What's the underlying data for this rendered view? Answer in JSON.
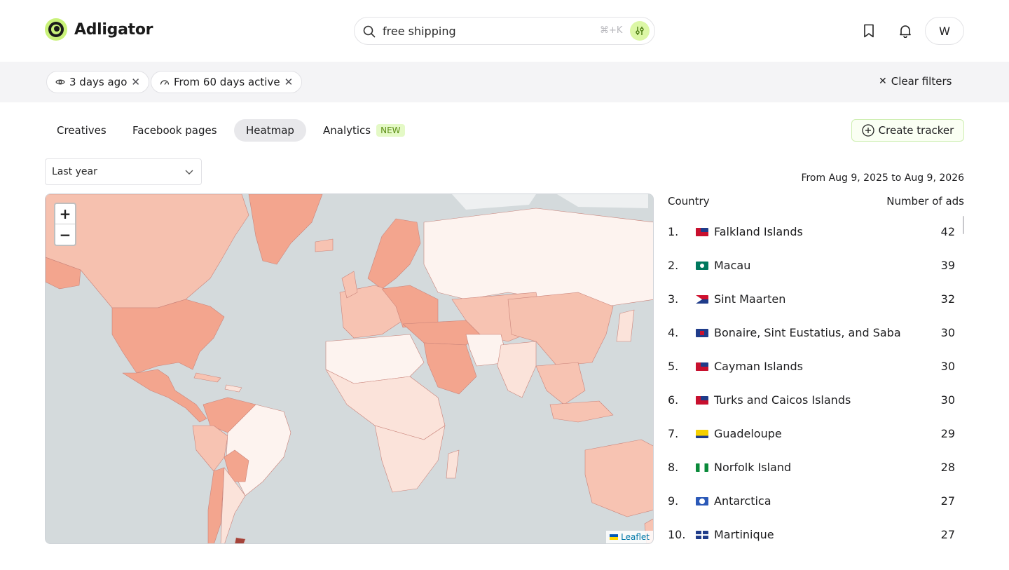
{
  "app": {
    "name": "Adligator"
  },
  "search": {
    "value": "free shipping",
    "shortcut": "⌘+K"
  },
  "user": {
    "initial": "W"
  },
  "filters": {
    "chips": [
      {
        "label": "3 days ago",
        "icon": "eye-icon"
      },
      {
        "label": "From 60 days active",
        "icon": "gauge-icon"
      }
    ],
    "clear_label": "Clear filters"
  },
  "tabs": [
    {
      "label": "Creatives",
      "active": false
    },
    {
      "label": "Facebook pages",
      "active": false
    },
    {
      "label": "Heatmap",
      "active": true
    },
    {
      "label": "Analytics",
      "active": false,
      "badge": "NEW"
    }
  ],
  "create_tracker_label": "Create tracker",
  "period": {
    "selected": "Last year"
  },
  "date_range": "From Aug 9, 2025 to Aug 9, 2026",
  "map": {
    "zoom_in": "+",
    "zoom_out": "−",
    "attribution": "Leaflet"
  },
  "table": {
    "col_country": "Country",
    "col_ads": "Number of ads",
    "rows": [
      {
        "rank": "1.",
        "country": "Falkland Islands",
        "ads": "42",
        "flag": "blue-ensign"
      },
      {
        "rank": "2.",
        "country": "Macau",
        "ads": "39",
        "flag": "green-white"
      },
      {
        "rank": "3.",
        "country": "Sint Maarten",
        "ads": "32",
        "flag": "red-white-blue"
      },
      {
        "rank": "4.",
        "country": "Bonaire, Sint Eustatius, and Saba",
        "ads": "30",
        "flag": "blue-red"
      },
      {
        "rank": "5.",
        "country": "Cayman Islands",
        "ads": "30",
        "flag": "blue-ensign"
      },
      {
        "rank": "6.",
        "country": "Turks and Caicos Islands",
        "ads": "30",
        "flag": "blue-ensign"
      },
      {
        "rank": "7.",
        "country": "Guadeloupe",
        "ads": "29",
        "flag": "yellow-blue"
      },
      {
        "rank": "8.",
        "country": "Norfolk Island",
        "ads": "28",
        "flag": "green-white-green"
      },
      {
        "rank": "9.",
        "country": "Antarctica",
        "ads": "27",
        "flag": "blue-white"
      },
      {
        "rank": "10.",
        "country": "Martinique",
        "ads": "27",
        "flag": "blue-white-cross"
      }
    ]
  },
  "colors": {
    "accent": "#c9f27a",
    "heat_high": "#f3a58e",
    "heat_mid": "#f7c3b2",
    "heat_low": "#fbe3da",
    "heat_none": "#fdf3ef",
    "water": "#d4dadc"
  }
}
